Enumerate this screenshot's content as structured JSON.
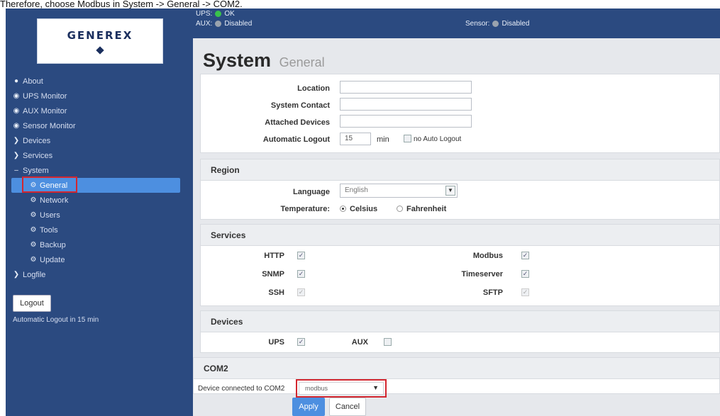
{
  "caption": "Therefore, choose Modbus in System -> General -> COM2.",
  "logo": {
    "text": "GENEREX"
  },
  "sidebar": {
    "items": [
      {
        "label": "About",
        "icon": "info-icon"
      },
      {
        "label": "UPS Monitor",
        "icon": "dashboard-icon"
      },
      {
        "label": "AUX Monitor",
        "icon": "dashboard-icon"
      },
      {
        "label": "Sensor Monitor",
        "icon": "dashboard-icon"
      },
      {
        "label": "Devices",
        "icon": "chevron-right-icon"
      },
      {
        "label": "Services",
        "icon": "chevron-right-icon"
      },
      {
        "label": "System",
        "icon": "minus-icon"
      },
      {
        "label": "General",
        "icon": "gear-icon",
        "active": true
      },
      {
        "label": "Network",
        "icon": "gear-icon"
      },
      {
        "label": "Users",
        "icon": "gear-icon"
      },
      {
        "label": "Tools",
        "icon": "gear-icon"
      },
      {
        "label": "Backup",
        "icon": "gear-icon"
      },
      {
        "label": "Update",
        "icon": "gear-icon"
      },
      {
        "label": "Logfile",
        "icon": "chevron-right-icon"
      }
    ],
    "logout_label": "Logout",
    "auto_logout_note": "Automatic Logout in 15 min"
  },
  "status": {
    "ups_label": "UPS:",
    "ups_value": "OK",
    "ups_color": "#39c24b",
    "aux_label": "AUX:",
    "aux_value": "Disabled",
    "sensor_label": "Sensor:",
    "sensor_value": "Disabled"
  },
  "page": {
    "title": "System",
    "subtitle": "General"
  },
  "general": {
    "location_label": "Location",
    "location_value": "",
    "contact_label": "System Contact",
    "contact_value": "",
    "attached_label": "Attached Devices",
    "attached_value": "",
    "logout_label": "Automatic Logout",
    "logout_value": "15",
    "logout_unit": "min",
    "no_auto_logout_label": "no Auto Logout"
  },
  "region": {
    "title": "Region",
    "language_label": "Language",
    "language_value": "English",
    "temperature_label": "Temperature:",
    "celsius_label": "Celsius",
    "fahrenheit_label": "Fahrenheit"
  },
  "services": {
    "title": "Services",
    "http": "HTTP",
    "snmp": "SNMP",
    "ssh": "SSH",
    "modbus": "Modbus",
    "timeserver": "Timeserver",
    "sftp": "SFTP"
  },
  "devices": {
    "title": "Devices",
    "ups": "UPS",
    "aux": "AUX"
  },
  "com2": {
    "title": "COM2",
    "label": "Device connected to COM2",
    "value": "modbus"
  },
  "actions": {
    "apply": "Apply",
    "cancel": "Cancel"
  }
}
